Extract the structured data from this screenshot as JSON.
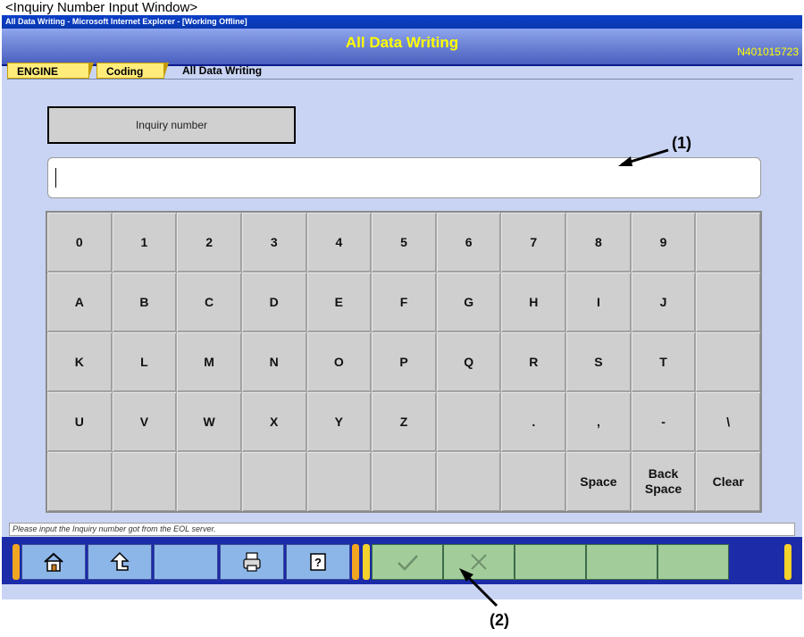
{
  "caption": "<Inquiry Number Input Window>",
  "window": {
    "ie_title": "All Data Writing - Microsoft Internet Explorer - [Working Offline]",
    "app_title": "All Data Writing",
    "app_id": "N401015723"
  },
  "breadcrumb": {
    "engine": "ENGINE",
    "coding": "Coding",
    "current": "All Data Writing"
  },
  "inquiry": {
    "label": "Inquiry number",
    "value": ""
  },
  "keypad": {
    "row1": [
      "0",
      "1",
      "2",
      "3",
      "4",
      "5",
      "6",
      "7",
      "8",
      "9",
      ""
    ],
    "row2": [
      "A",
      "B",
      "C",
      "D",
      "E",
      "F",
      "G",
      "H",
      "I",
      "J",
      ""
    ],
    "row3": [
      "K",
      "L",
      "M",
      "N",
      "O",
      "P",
      "Q",
      "R",
      "S",
      "T",
      ""
    ],
    "row4": [
      "U",
      "V",
      "W",
      "X",
      "Y",
      "Z",
      "",
      ".",
      ",",
      "-",
      "\\"
    ],
    "row5": [
      "",
      "",
      "",
      "",
      "",
      "",
      "",
      "",
      "Space",
      "Back Space",
      "Clear"
    ]
  },
  "status_message": "Please input the Inquiry number got from the EOL server.",
  "toolbar": {
    "left_icons": [
      "home-icon",
      "up-arrow-icon",
      "",
      "printer-icon",
      "help-icon"
    ],
    "right_icons": [
      "checkmark-icon",
      "cross-icon",
      "",
      "",
      ""
    ]
  },
  "annotations": {
    "a1": "(1)",
    "a2": "(2)"
  }
}
